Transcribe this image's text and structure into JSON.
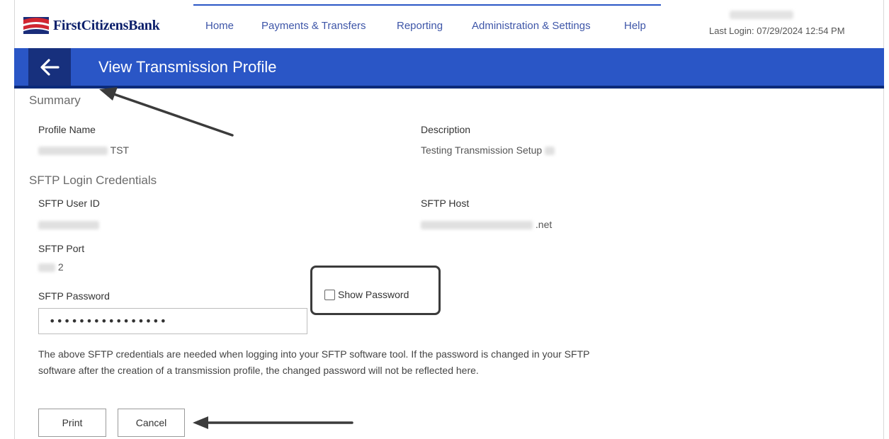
{
  "header": {
    "logo_text": "FirstCitizensBank",
    "nav": [
      {
        "label": "Home"
      },
      {
        "label": "Payments & Transfers"
      },
      {
        "label": "Reporting"
      },
      {
        "label": "Administration & Settings"
      },
      {
        "label": "Help"
      }
    ],
    "last_login": "Last Login: 07/29/2024 12:54 PM"
  },
  "titlebar": {
    "title": "View Transmission Profile",
    "back_icon": "arrow-left-icon"
  },
  "summary": {
    "heading": "Summary",
    "profile_name_label": "Profile Name",
    "profile_name_suffix": "TST",
    "description_label": "Description",
    "description_value": "Testing Transmission Setup"
  },
  "sftp": {
    "heading": "SFTP Login Credentials",
    "user_id_label": "SFTP User ID",
    "host_label": "SFTP Host",
    "host_suffix": ".net",
    "port_label": "SFTP Port",
    "port_suffix": "2",
    "password_label": "SFTP Password",
    "password_value": "••••••••••••••••",
    "show_password_label": "Show Password",
    "note": "The above SFTP credentials are needed when logging into your SFTP software tool. If the password is changed in your SFTP software after the creation of a transmission profile, the changed password will not be reflected here."
  },
  "buttons": {
    "print": "Print",
    "cancel": "Cancel"
  },
  "colors": {
    "brand_blue": "#2a56c6",
    "brand_dark": "#17307d",
    "nav_text": "#3e56a8"
  }
}
